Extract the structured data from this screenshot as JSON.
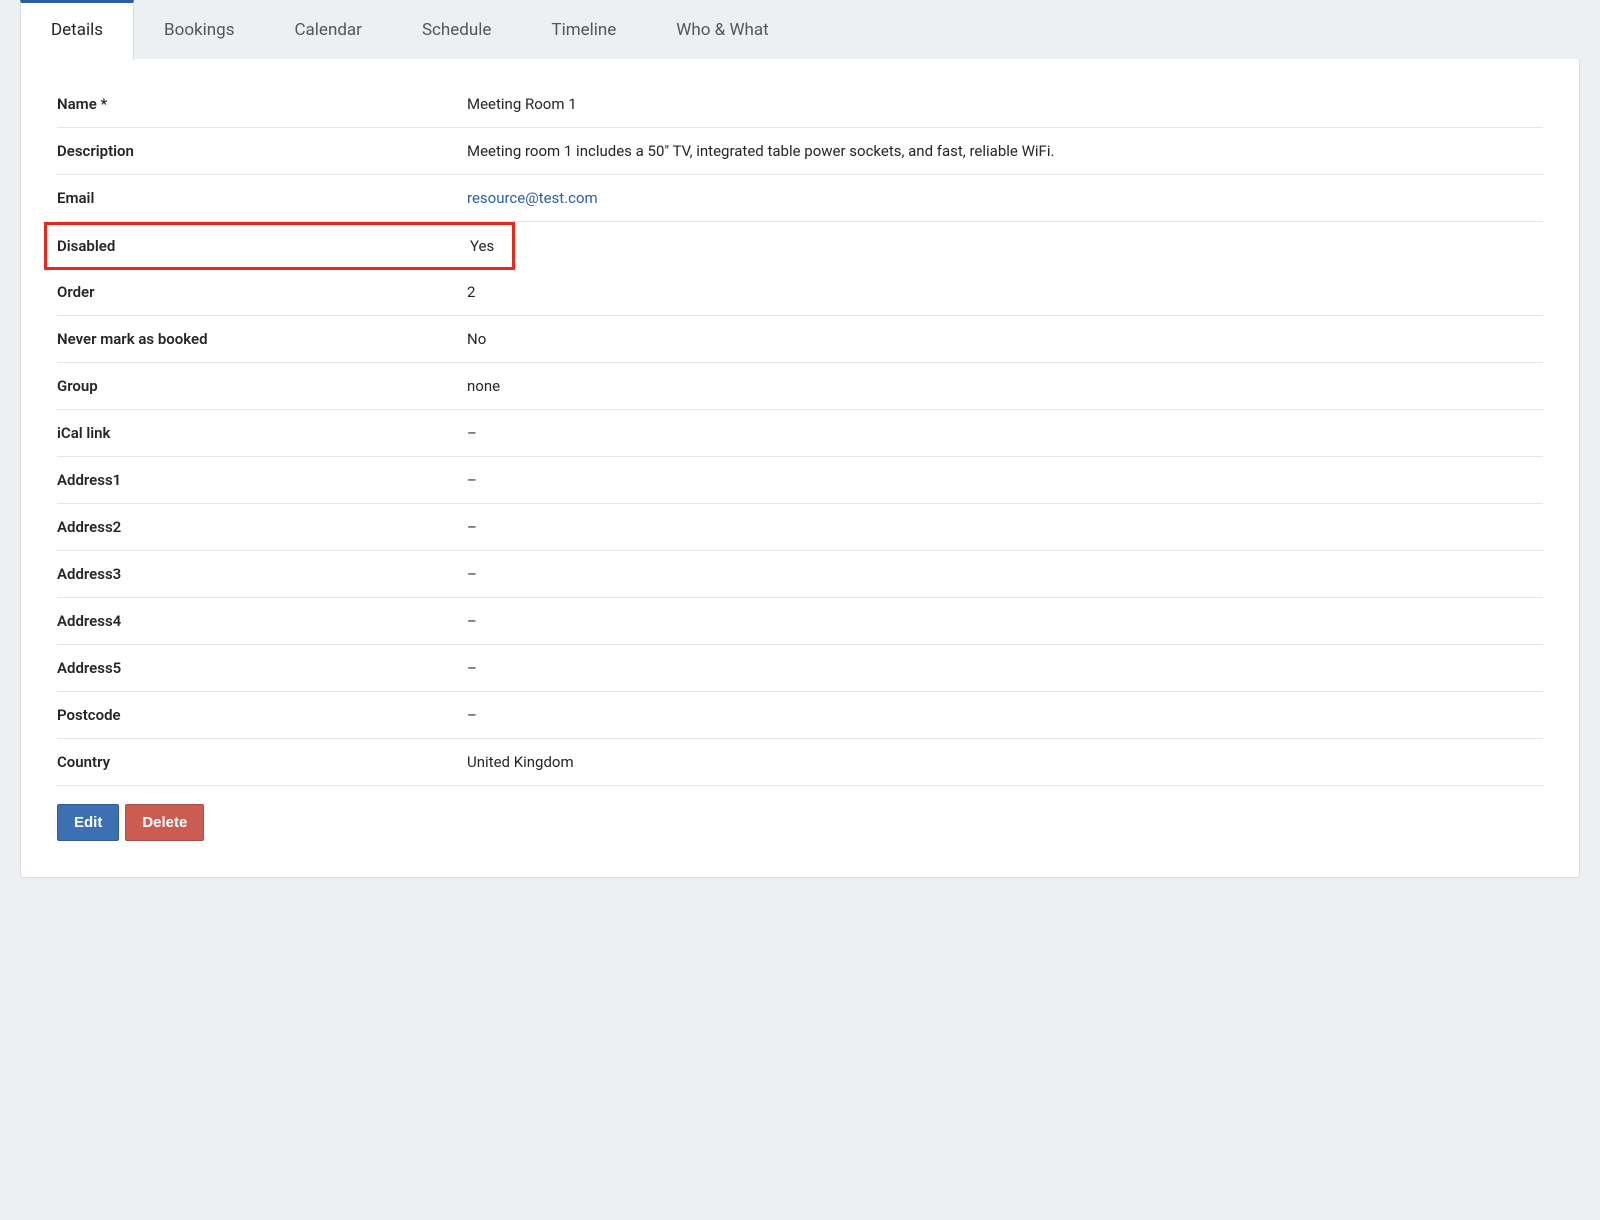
{
  "tabs": [
    {
      "label": "Details",
      "active": true
    },
    {
      "label": "Bookings",
      "active": false
    },
    {
      "label": "Calendar",
      "active": false
    },
    {
      "label": "Schedule",
      "active": false
    },
    {
      "label": "Timeline",
      "active": false
    },
    {
      "label": "Who & What",
      "active": false
    }
  ],
  "details": {
    "rows": [
      {
        "label": "Name *",
        "value": "Meeting Room 1",
        "highlighted": false,
        "isLink": false
      },
      {
        "label": "Description",
        "value": "Meeting room 1 includes a 50\" TV, integrated table power sockets, and fast, reliable WiFi.",
        "highlighted": false,
        "isLink": false
      },
      {
        "label": "Email",
        "value": "resource@test.com",
        "highlighted": false,
        "isLink": true
      },
      {
        "label": "Disabled",
        "value": "Yes",
        "highlighted": true,
        "isLink": false
      },
      {
        "label": "Order",
        "value": "2",
        "highlighted": false,
        "isLink": false
      },
      {
        "label": "Never mark as booked",
        "value": "No",
        "highlighted": false,
        "isLink": false
      },
      {
        "label": "Group",
        "value": "none",
        "highlighted": false,
        "isLink": false
      },
      {
        "label": "iCal link",
        "value": "–",
        "highlighted": false,
        "isLink": false
      },
      {
        "label": "Address1",
        "value": "–",
        "highlighted": false,
        "isLink": false
      },
      {
        "label": "Address2",
        "value": "–",
        "highlighted": false,
        "isLink": false
      },
      {
        "label": "Address3",
        "value": "–",
        "highlighted": false,
        "isLink": false
      },
      {
        "label": "Address4",
        "value": "–",
        "highlighted": false,
        "isLink": false
      },
      {
        "label": "Address5",
        "value": "–",
        "highlighted": false,
        "isLink": false
      },
      {
        "label": "Postcode",
        "value": "–",
        "highlighted": false,
        "isLink": false
      },
      {
        "label": "Country",
        "value": "United Kingdom",
        "highlighted": false,
        "isLink": false
      }
    ]
  },
  "buttons": {
    "edit": "Edit",
    "delete": "Delete"
  }
}
